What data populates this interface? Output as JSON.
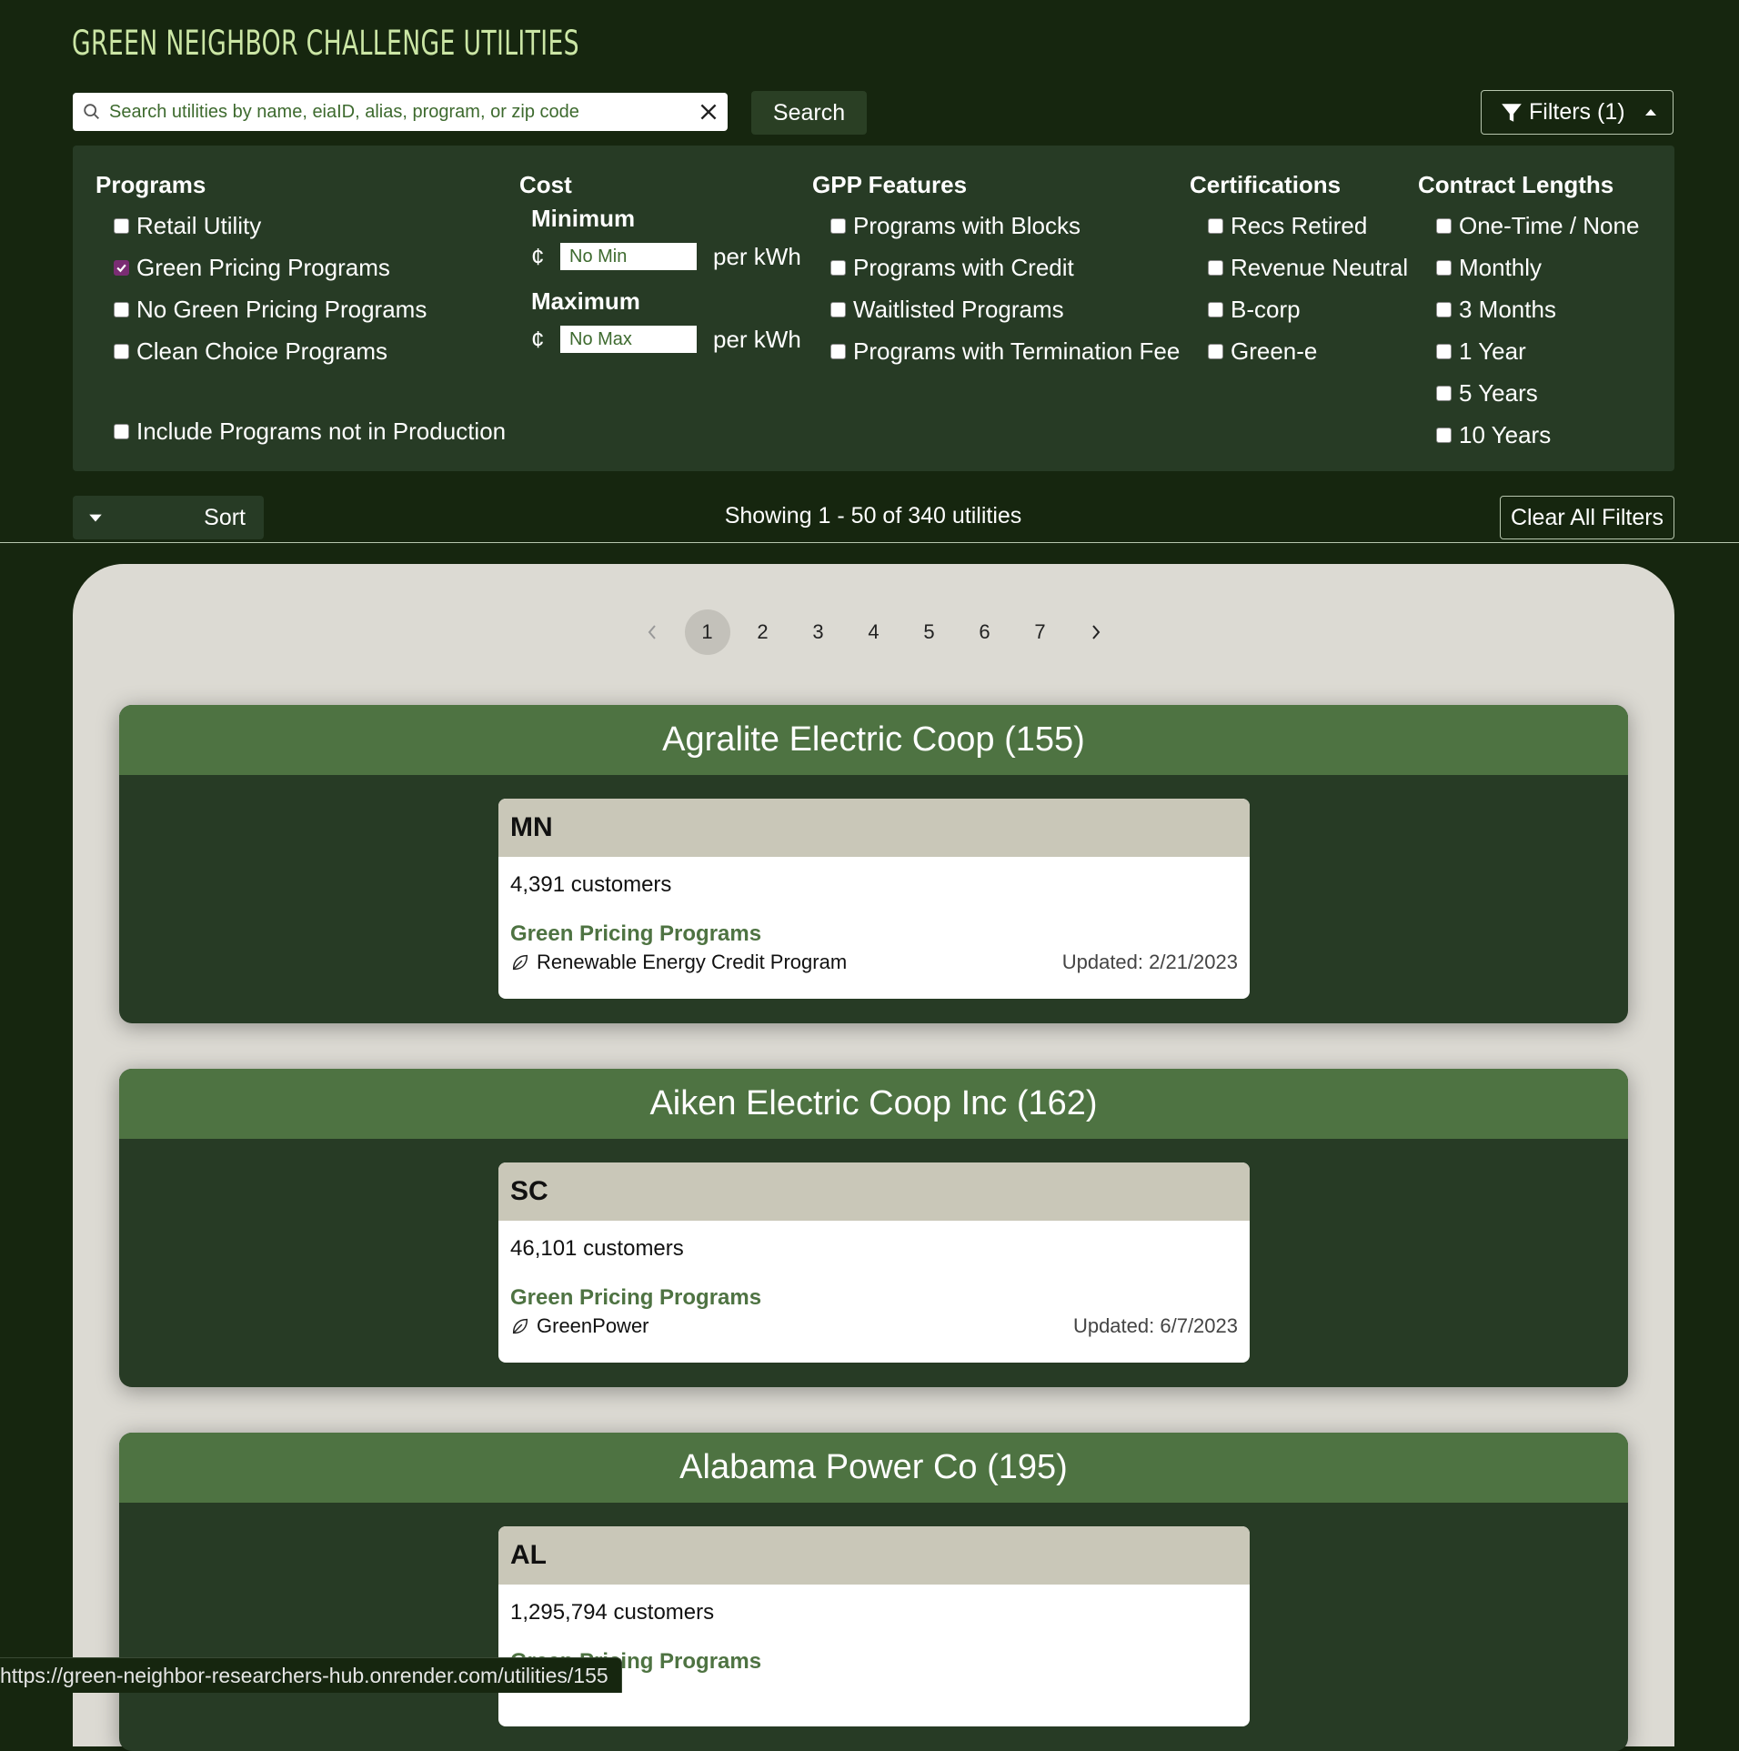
{
  "app": {
    "title": "Green Neighbor Challenge Utilities"
  },
  "search": {
    "placeholder": "Search utilities by name, eiaID, alias, program, or zip code",
    "value": "",
    "button_label": "Search"
  },
  "filters_button": {
    "label": "Filters (1)"
  },
  "filters": {
    "programs": {
      "heading": "Programs",
      "options": [
        {
          "label": "Retail Utility",
          "checked": false
        },
        {
          "label": "Green Pricing Programs",
          "checked": true
        },
        {
          "label": "No Green Pricing Programs",
          "checked": false
        },
        {
          "label": "Clean Choice Programs",
          "checked": false
        }
      ],
      "production_option": {
        "label": "Include Programs not in Production",
        "checked": false
      }
    },
    "cost": {
      "heading": "Cost",
      "minimum_label": "Minimum",
      "maximum_label": "Maximum",
      "currency": "¢",
      "unit": "per kWh",
      "min_placeholder": "No Min",
      "max_placeholder": "No Max"
    },
    "gpp_features": {
      "heading": "GPP Features",
      "options": [
        {
          "label": "Programs with Blocks",
          "checked": false
        },
        {
          "label": "Programs with Credit",
          "checked": false
        },
        {
          "label": "Waitlisted Programs",
          "checked": false
        },
        {
          "label": "Programs with Termination Fee",
          "checked": false
        }
      ]
    },
    "certifications": {
      "heading": "Certifications",
      "options": [
        {
          "label": "Recs Retired",
          "checked": false
        },
        {
          "label": "Revenue Neutral",
          "checked": false
        },
        {
          "label": "B-corp",
          "checked": false
        },
        {
          "label": "Green-e",
          "checked": false
        }
      ]
    },
    "contract_lengths": {
      "heading": "Contract Lengths",
      "options": [
        {
          "label": "One-Time / None",
          "checked": false
        },
        {
          "label": "Monthly",
          "checked": false
        },
        {
          "label": "3 Months",
          "checked": false
        },
        {
          "label": "1 Year",
          "checked": false
        },
        {
          "label": "5 Years",
          "checked": false
        },
        {
          "label": "10 Years",
          "checked": false
        }
      ]
    }
  },
  "toolbar": {
    "sort_label": "Sort",
    "showing_text": "Showing 1 - 50 of 340 utilities",
    "clear_label": "Clear All Filters"
  },
  "pagination": {
    "prev": "‹",
    "next": "›",
    "pages": [
      "1",
      "2",
      "3",
      "4",
      "5",
      "6",
      "7"
    ],
    "current": "1"
  },
  "utilities": [
    {
      "name": "Agralite Electric Coop (155)",
      "state": "MN",
      "customers": "4,391 customers",
      "programs_heading": "Green Pricing Programs",
      "program": "Renewable Energy Credit Program",
      "updated": "Updated: 2/21/2023"
    },
    {
      "name": "Aiken Electric Coop Inc (162)",
      "state": "SC",
      "customers": "46,101 customers",
      "programs_heading": "Green Pricing Programs",
      "program": "GreenPower",
      "updated": "Updated: 6/7/2023"
    },
    {
      "name": "Alabama Power Co (195)",
      "state": "AL",
      "customers": "1,295,794 customers",
      "programs_heading": "Green Pricing Programs",
      "program": "",
      "updated": ""
    }
  ],
  "status_bar": {
    "url": "https://green-neighbor-researchers-hub.onrender.com/utilities/155"
  },
  "colors": {
    "background": "#16260f",
    "panel": "#273b25",
    "accent_green": "#4e7342",
    "title_green": "#cbe6a5",
    "checkbox_checked": "#7a2d73",
    "results_bg": "#dcdad3"
  }
}
